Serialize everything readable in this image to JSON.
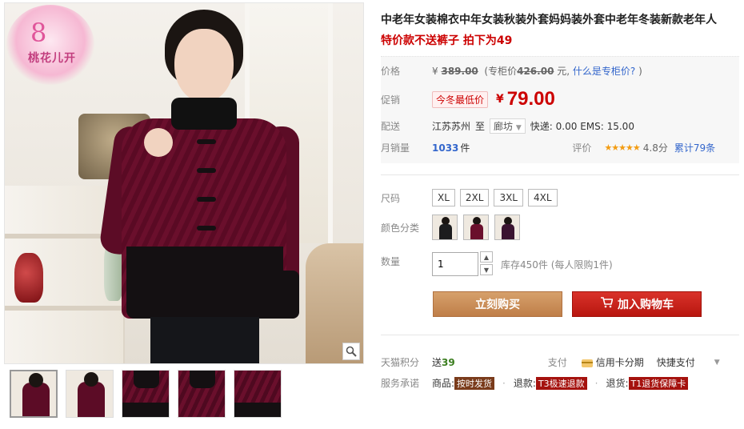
{
  "gallery": {
    "logo_glyph": "8",
    "logo_text": "桃花儿开",
    "thumbnails": [
      {
        "name": "thumb-front",
        "style": "full"
      },
      {
        "name": "thumb-back",
        "style": "full"
      },
      {
        "name": "thumb-detail-collar",
        "style": "close"
      },
      {
        "name": "thumb-detail-front",
        "style": "close"
      },
      {
        "name": "thumb-detail-sleeve",
        "style": "close"
      }
    ]
  },
  "product": {
    "title": "中老年女装棉衣中年女装秋装外套妈妈装外套中老年冬装新款老年人",
    "subtitle": "特价款不送裤子 拍下为49"
  },
  "price": {
    "label": "价格",
    "yen": "¥",
    "original": "389.00",
    "counter_prefix": "(专柜价",
    "counter_value": "426.00",
    "counter_suffix": "元,",
    "counter_link": "什么是专柜价?",
    "counter_close": ")"
  },
  "promo": {
    "label": "促销",
    "badge": "今冬最低价",
    "yen": "¥",
    "price": "79.00"
  },
  "shipping": {
    "label": "配送",
    "origin": "江苏苏州",
    "to": "至",
    "destination": "廊坊",
    "fees": "快递: 0.00 EMS: 15.00"
  },
  "sales": {
    "label": "月销量",
    "count": "1033",
    "unit": "件",
    "rating_label": "评价",
    "stars": "★★★★★",
    "score": "4.8分",
    "reviews": "累计79条"
  },
  "options": {
    "size_label": "尺码",
    "sizes": [
      "XL",
      "2XL",
      "3XL",
      "4XL"
    ],
    "color_label": "颜色分类"
  },
  "quantity": {
    "label": "数量",
    "value": "1",
    "stock": "库存450件 (每人限购1件)"
  },
  "actions": {
    "buy_now": "立刻购买",
    "add_to_cart": "加入购物车"
  },
  "extra": {
    "points_label": "天猫积分",
    "points_prefix": "送",
    "points_value": "39",
    "pay_label": "支付",
    "credit": "信用卡分期",
    "quick_pay": "快捷支付",
    "service_label": "服务承诺",
    "goods_label": "商品:",
    "goods_tag": "按时发货",
    "refund_label": "退款:",
    "refund_code": "T3",
    "refund_tag": "极速退款",
    "return_label": "退货:",
    "return_code": "T1",
    "return_tag": "退货保障卡"
  },
  "colors": {
    "accent_red": "#cc0000",
    "buy_button": "#c88b55",
    "cart_button": "#c81e17",
    "jacket": "#6a0f2c"
  }
}
